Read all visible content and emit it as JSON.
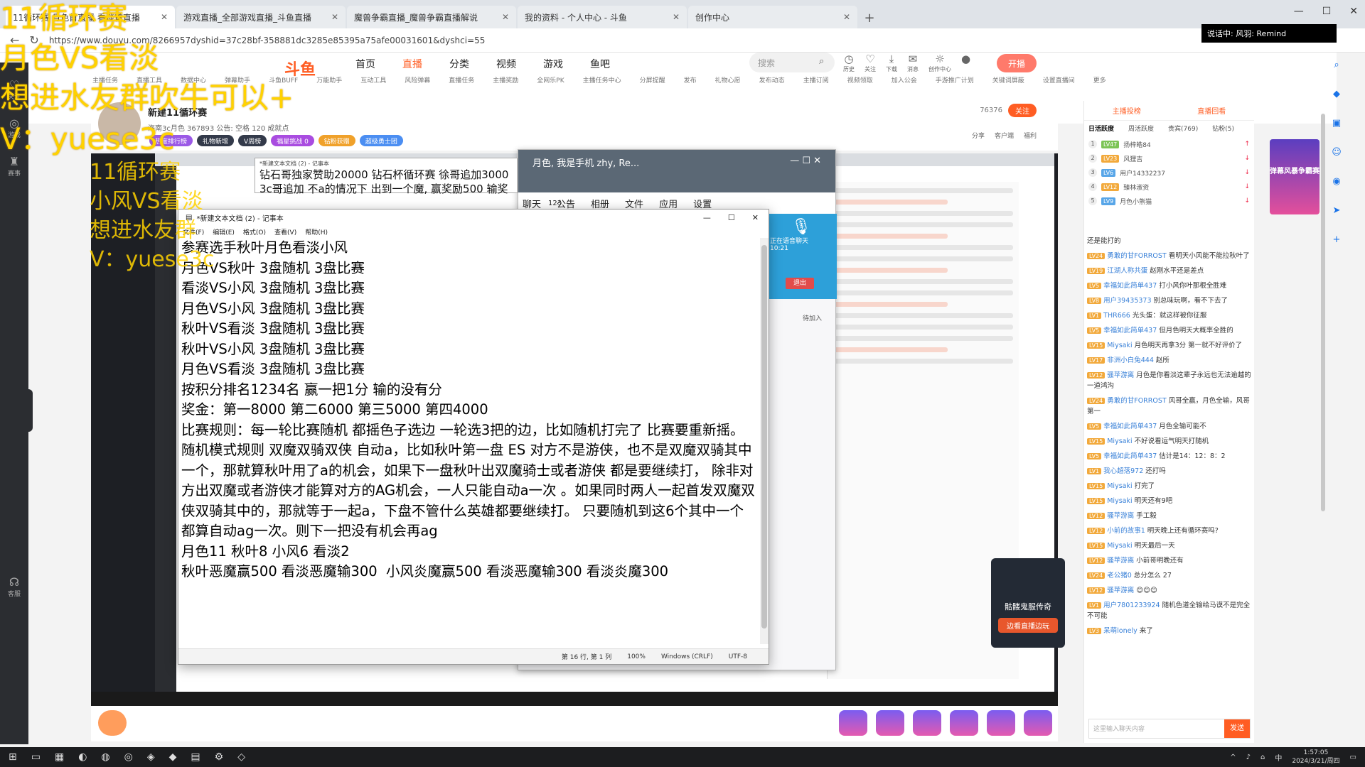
{
  "browser": {
    "tabs": [
      {
        "label": "11循环赛 月色首直播 看淡首直播",
        "active": true
      },
      {
        "label": "游戏直播_全部游戏直播_斗鱼直播"
      },
      {
        "label": "魔兽争霸直播_魔兽争霸直播解说"
      },
      {
        "label": "我的资料 - 个人中心 - 斗鱼"
      },
      {
        "label": "创作中心"
      }
    ],
    "url": "https://www.douyu.com/8266957dyshid=37c28bf-358881dc3285e85395a75afe00031601&dyshci=55",
    "banner_text": "说话中: 风羽: Remind"
  },
  "site": {
    "logo": "斗鱼",
    "nav": [
      "首页",
      "直播",
      "分类",
      "视频",
      "游戏",
      "鱼吧"
    ],
    "active_nav": "直播",
    "search_placeholder": "搜索",
    "user_icons": [
      "历史",
      "关注",
      "下载",
      "消息",
      "创作中心"
    ],
    "live_button": "开播",
    "sub_nav": [
      "主播任务",
      "直播工具",
      "数据中心",
      "弹幕助手",
      "斗鱼BUFF",
      "万能助手",
      "互动工具",
      "风险弹幕",
      "直播任务",
      "主播奖励",
      "全网乐PK",
      "主播任务中心",
      "分屏提醒",
      "发布",
      "礼物心愿",
      "发布动态",
      "主播订阅",
      "视频领取",
      "加入公会",
      "手游推广计划",
      "关键词屏蔽",
      "设置直播间",
      "更多"
    ]
  },
  "room": {
    "title": "新建11循环赛",
    "meta": "海南3c月色  367893  公告: 空格  120 成就点",
    "badges": [
      {
        "label": "热度排行榜",
        "color": "#9b59e6"
      },
      {
        "label": "礼物新增",
        "color": "#333a4a"
      },
      {
        "label": "V周榜",
        "color": "#333a4a"
      },
      {
        "label": "福星挑战 0",
        "color": "#a94ce0"
      },
      {
        "label": "钻粉获赠",
        "color": "#f0a12a"
      },
      {
        "label": "超级勇士团",
        "color": "#4b8ef2"
      }
    ],
    "follow_count": "76376",
    "follow_label": "关注",
    "actions": [
      "分享",
      "客户端",
      "福利"
    ]
  },
  "rail": [
    "关注",
    "游戏",
    "赛事",
    "客服"
  ],
  "qq": {
    "title": "月色, 我是手机 zhy, Re...",
    "tabs": [
      "聊天",
      "公告",
      "相册",
      "文件",
      "应用",
      "设置"
    ],
    "count": "123",
    "voice": "正在语音聊天",
    "time": "10:21",
    "exit": "退出",
    "invite": "待加入"
  },
  "bg_notepad": {
    "title": "*新建文本文档 (2) - 记事本",
    "line1": "钻石哥独家赞助20000 钻石杯循环赛 徐哥追加3000",
    "line2": "3c哥追加 不a的情况下 出到一个魔, 赢奖励500 输奖"
  },
  "notepad": {
    "title": "*新建文本文档 (2) - 记事本",
    "menu": [
      "文件(F)",
      "编辑(E)",
      "格式(O)",
      "查看(V)",
      "帮助(H)"
    ],
    "content": "参赛选手秋叶月色看淡小风\n月色VS秋叶 3盘随机 3盘比赛\n看淡VS小风 3盘随机 3盘比赛\n月色VS小风 3盘随机 3盘比赛\n秋叶VS看淡 3盘随机 3盘比赛\n秋叶VS小风 3盘随机 3盘比赛\n月色VS看淡 3盘随机 3盘比赛\n按积分排名1234名 赢一把1分 输的没有分\n奖金：第一8000 第二6000 第三5000 第四4000\n比赛规则：每一轮比赛随机 都摇色子选边 一轮选3把的边，比如随机打完了 比赛要重新摇。 随机模式规则 双魔双骑双侠 自动a，比如秋叶第一盘 ES 对方不是游侠，也不是双魔双骑其中一个，那就算秋叶用了a的机会，如果下一盘秋叶出双魔骑士或者游侠 都是要继续打， 除非对方出双魔或者游侠才能算对方的AG机会，一人只能自动a一次 。如果同时两人一起首发双魔双侠双骑其中的，那就等于一起a，下盘不管什么英雄都要继续打。 只要随机到这6个其中一个都算自动ag一次。则下一把没有机会再ag\n月色11 秋叶8 小风6 看淡2\n秋叶恶魔赢500 看淡恶魔输300  小风炎魔赢500 看淡恶魔输300 看淡炎魔300\n",
    "status": [
      "第 16 行, 第 1 列",
      "100%",
      "Windows (CRLF)",
      "UTF-8"
    ]
  },
  "promo": {
    "title": "骷髅鬼服传奇",
    "button": "边看直播边玩"
  },
  "chat_panel": {
    "top_tabs": [
      "主播投榜",
      "直播回看"
    ],
    "sub_tabs": [
      "日活跃度",
      "周活跃度",
      "贵宾(769)",
      "钻粉(5)"
    ],
    "rank": [
      {
        "n": "1",
        "lv": "LV47",
        "name": "扬梓皓84"
      },
      {
        "n": "2",
        "lv": "LV23",
        "name": "风狸吉"
      },
      {
        "n": "3",
        "lv": "LV6",
        "name": "用户14332237"
      },
      {
        "n": "4",
        "lv": "LV12",
        "name": "臻林淑资"
      },
      {
        "n": "5",
        "lv": "LV9",
        "name": "月色小熊猫"
      }
    ],
    "messages": [
      {
        "lv": "",
        "name": "",
        "text": "还是能打的"
      },
      {
        "lv": "LV24",
        "name": "勇敢的甘FORROST",
        "text": "看明天小风能不能拉秋叶了"
      },
      {
        "lv": "LV19",
        "name": "江湖人称共蛋",
        "text": "赵刚水平还是差点"
      },
      {
        "lv": "LV5",
        "name": "幸福如此简单437",
        "text": "打小风你叶那根全胜难"
      },
      {
        "lv": "LV8",
        "name": "用户39435373",
        "text": "别总味玩啊，看不下去了"
      },
      {
        "lv": "LV1",
        "name": "THR666",
        "text": "光头蛋：就这样被你征服"
      },
      {
        "lv": "LV5",
        "name": "幸福如此简单437",
        "text": "但月色明天大概率全胜的"
      },
      {
        "lv": "LV15",
        "name": "Miysaki",
        "text": "月色明天再拿3分 第一就不好评价了"
      },
      {
        "lv": "LV17",
        "name": "非洲小白兔444",
        "text": "赵所"
      },
      {
        "lv": "LV12",
        "name": "骚苹游离",
        "text": "月色是你看淡这辈子永远也无法逾越的一道鸿沟"
      },
      {
        "lv": "LV24",
        "name": "勇敢的甘FORROST",
        "text": "风哥全赢，月色全输，风哥第一"
      },
      {
        "lv": "LV5",
        "name": "幸福如此简单437",
        "text": "月色全输可能不"
      },
      {
        "lv": "LV15",
        "name": "Miysaki",
        "text": "不好说看运气明天打随机"
      },
      {
        "lv": "LV5",
        "name": "幸福如此简单437",
        "text": "估计是14：12：8：2"
      },
      {
        "lv": "LV1",
        "name": "我心超落972",
        "text": "还打吗"
      },
      {
        "lv": "LV15",
        "name": "Miysaki",
        "text": "打完了"
      },
      {
        "lv": "LV15",
        "name": "Miysaki",
        "text": "明天还有9吧"
      },
      {
        "lv": "LV12",
        "name": "骚苹游离",
        "text": "手工毅"
      },
      {
        "lv": "LV12",
        "name": "小前的故事1",
        "text": "明天晚上还有循环赛吗?"
      },
      {
        "lv": "LV15",
        "name": "Miysaki",
        "text": "明天最后一天"
      },
      {
        "lv": "LV12",
        "name": "骚苹游离",
        "text": "小前哥明晚还有"
      },
      {
        "lv": "LV24",
        "name": "老公猪0",
        "text": "总分怎么 27"
      },
      {
        "lv": "LV12",
        "name": "骚苹游离",
        "text": "😊😊😊"
      },
      {
        "lv": "LV1",
        "name": "用户7801233924",
        "text": "随机色道全输给马谟不是完全不可能"
      },
      {
        "lv": "LV3",
        "name": "呆萌lonely",
        "text": "来了"
      }
    ],
    "input_placeholder": "这里输入聊天内容",
    "send": "发送"
  },
  "ad": "弹幕风暴争霸赛",
  "taskbar": {
    "time": "1:57:05",
    "date": "2024/3/21/周四"
  },
  "overlay": {
    "lines": [
      "11循环赛",
      "月色VS看淡",
      "想进水友群吹牛可以+",
      "V：yuese3c"
    ],
    "small_lines": [
      "11循环赛",
      "小风VS看淡",
      "想进水友群",
      "V：yuese3c"
    ]
  }
}
